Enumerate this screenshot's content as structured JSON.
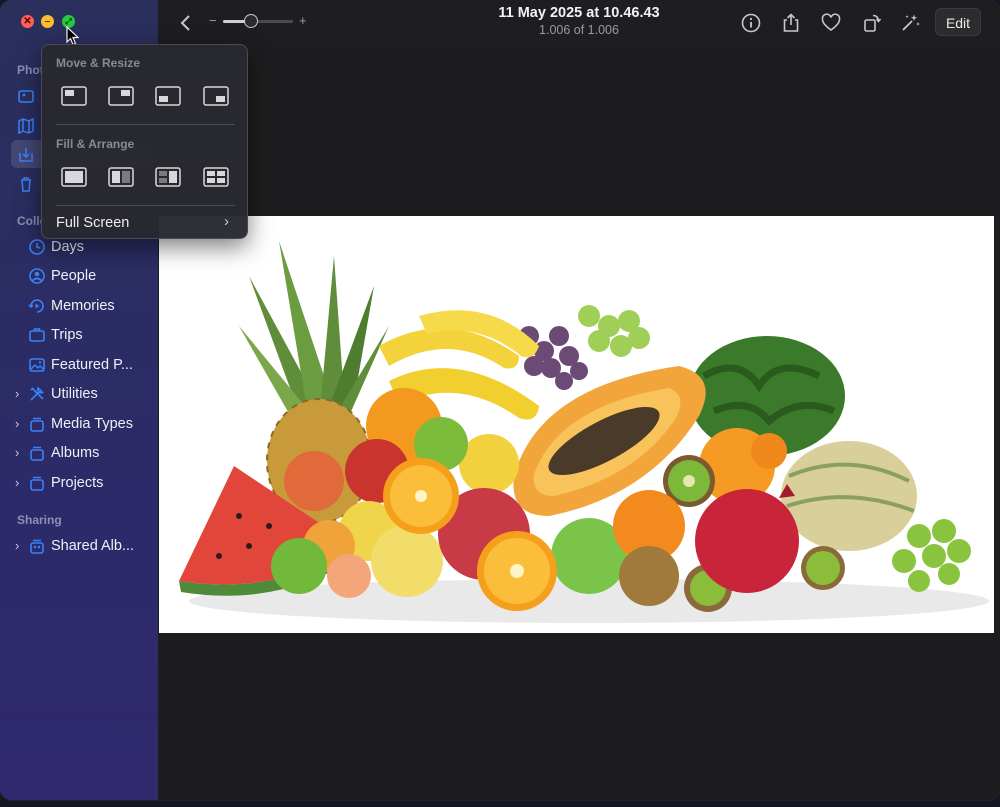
{
  "window": {
    "controls": [
      "close",
      "minimize",
      "maximize"
    ],
    "control_glyphs": {
      "close": "✕",
      "minimize": "–",
      "maximize": "⤢"
    }
  },
  "sidebar": {
    "sections": {
      "photos": "Photo",
      "collections": "Colle",
      "sharing": "Sharing"
    },
    "items": [
      {
        "label": "Days",
        "icon": "clock-icon"
      },
      {
        "label": "People",
        "icon": "person-circle-icon"
      },
      {
        "label": "Memories",
        "icon": "memories-icon"
      },
      {
        "label": "Trips",
        "icon": "suitcase-icon"
      },
      {
        "label": "Featured P...",
        "icon": "photo-icon"
      },
      {
        "label": "Utilities",
        "icon": "tools-icon",
        "expandable": true
      },
      {
        "label": "Media Types",
        "icon": "stack-icon",
        "expandable": true
      },
      {
        "label": "Albums",
        "icon": "stack-icon",
        "expandable": true
      },
      {
        "label": "Projects",
        "icon": "stack-icon",
        "expandable": true
      },
      {
        "label": "Shared Alb...",
        "icon": "shared-stack-icon",
        "expandable": true
      }
    ],
    "expand_glyph": "›"
  },
  "toolbar": {
    "title": "11 May 2025 at 10.46.43",
    "subtitle": "1.006 of 1.006",
    "zoom_minus": "−",
    "zoom_plus": "+",
    "zoom_level": 0.4,
    "edit_label": "Edit"
  },
  "popover": {
    "move_resize_label": "Move & Resize",
    "fill_arrange_label": "Fill & Arrange",
    "full_screen_label": "Full Screen",
    "chevron": "›"
  },
  "colors": {
    "accent": "#3a82f7",
    "close": "#fe5f57",
    "minimize": "#febc2e",
    "maximize": "#28c840"
  }
}
